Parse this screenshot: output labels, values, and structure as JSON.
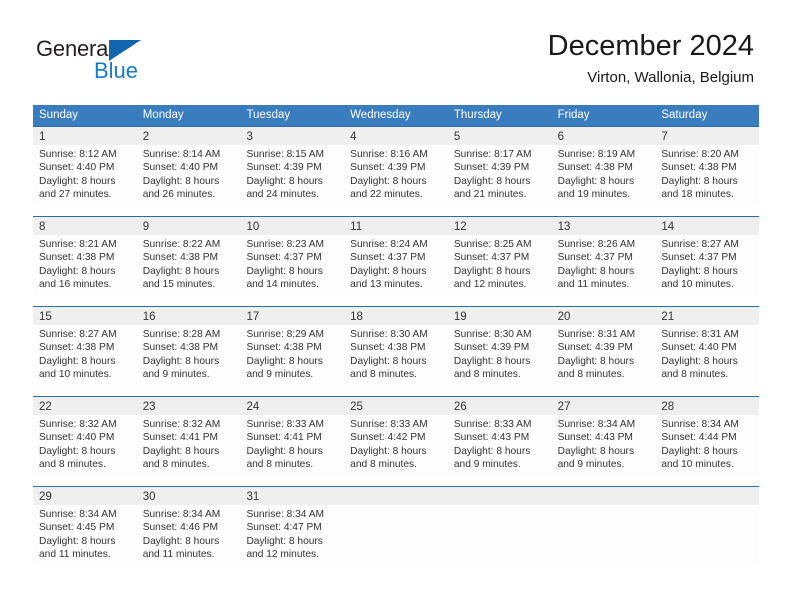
{
  "brand": {
    "name_part1": "General",
    "name_part2": "Blue",
    "accent_color": "#1a7ac4",
    "triangle_color": "#1166b0"
  },
  "header": {
    "title": "December 2024",
    "subtitle": "Virton, Wallonia, Belgium"
  },
  "theme": {
    "header_row_bg": "#3a7dbe",
    "week_separator": "#2b6ca8",
    "daynum_band_bg": "#efefef",
    "cell_bg": "#fdfdfd",
    "text_color": "#333333"
  },
  "weekdays": [
    "Sunday",
    "Monday",
    "Tuesday",
    "Wednesday",
    "Thursday",
    "Friday",
    "Saturday"
  ],
  "weeks": [
    [
      {
        "day": "1",
        "sunrise": "Sunrise: 8:12 AM",
        "sunset": "Sunset: 4:40 PM",
        "daylight1": "Daylight: 8 hours",
        "daylight2": "and 27 minutes."
      },
      {
        "day": "2",
        "sunrise": "Sunrise: 8:14 AM",
        "sunset": "Sunset: 4:40 PM",
        "daylight1": "Daylight: 8 hours",
        "daylight2": "and 26 minutes."
      },
      {
        "day": "3",
        "sunrise": "Sunrise: 8:15 AM",
        "sunset": "Sunset: 4:39 PM",
        "daylight1": "Daylight: 8 hours",
        "daylight2": "and 24 minutes."
      },
      {
        "day": "4",
        "sunrise": "Sunrise: 8:16 AM",
        "sunset": "Sunset: 4:39 PM",
        "daylight1": "Daylight: 8 hours",
        "daylight2": "and 22 minutes."
      },
      {
        "day": "5",
        "sunrise": "Sunrise: 8:17 AM",
        "sunset": "Sunset: 4:39 PM",
        "daylight1": "Daylight: 8 hours",
        "daylight2": "and 21 minutes."
      },
      {
        "day": "6",
        "sunrise": "Sunrise: 8:19 AM",
        "sunset": "Sunset: 4:38 PM",
        "daylight1": "Daylight: 8 hours",
        "daylight2": "and 19 minutes."
      },
      {
        "day": "7",
        "sunrise": "Sunrise: 8:20 AM",
        "sunset": "Sunset: 4:38 PM",
        "daylight1": "Daylight: 8 hours",
        "daylight2": "and 18 minutes."
      }
    ],
    [
      {
        "day": "8",
        "sunrise": "Sunrise: 8:21 AM",
        "sunset": "Sunset: 4:38 PM",
        "daylight1": "Daylight: 8 hours",
        "daylight2": "and 16 minutes."
      },
      {
        "day": "9",
        "sunrise": "Sunrise: 8:22 AM",
        "sunset": "Sunset: 4:38 PM",
        "daylight1": "Daylight: 8 hours",
        "daylight2": "and 15 minutes."
      },
      {
        "day": "10",
        "sunrise": "Sunrise: 8:23 AM",
        "sunset": "Sunset: 4:37 PM",
        "daylight1": "Daylight: 8 hours",
        "daylight2": "and 14 minutes."
      },
      {
        "day": "11",
        "sunrise": "Sunrise: 8:24 AM",
        "sunset": "Sunset: 4:37 PM",
        "daylight1": "Daylight: 8 hours",
        "daylight2": "and 13 minutes."
      },
      {
        "day": "12",
        "sunrise": "Sunrise: 8:25 AM",
        "sunset": "Sunset: 4:37 PM",
        "daylight1": "Daylight: 8 hours",
        "daylight2": "and 12 minutes."
      },
      {
        "day": "13",
        "sunrise": "Sunrise: 8:26 AM",
        "sunset": "Sunset: 4:37 PM",
        "daylight1": "Daylight: 8 hours",
        "daylight2": "and 11 minutes."
      },
      {
        "day": "14",
        "sunrise": "Sunrise: 8:27 AM",
        "sunset": "Sunset: 4:37 PM",
        "daylight1": "Daylight: 8 hours",
        "daylight2": "and 10 minutes."
      }
    ],
    [
      {
        "day": "15",
        "sunrise": "Sunrise: 8:27 AM",
        "sunset": "Sunset: 4:38 PM",
        "daylight1": "Daylight: 8 hours",
        "daylight2": "and 10 minutes."
      },
      {
        "day": "16",
        "sunrise": "Sunrise: 8:28 AM",
        "sunset": "Sunset: 4:38 PM",
        "daylight1": "Daylight: 8 hours",
        "daylight2": "and 9 minutes."
      },
      {
        "day": "17",
        "sunrise": "Sunrise: 8:29 AM",
        "sunset": "Sunset: 4:38 PM",
        "daylight1": "Daylight: 8 hours",
        "daylight2": "and 9 minutes."
      },
      {
        "day": "18",
        "sunrise": "Sunrise: 8:30 AM",
        "sunset": "Sunset: 4:38 PM",
        "daylight1": "Daylight: 8 hours",
        "daylight2": "and 8 minutes."
      },
      {
        "day": "19",
        "sunrise": "Sunrise: 8:30 AM",
        "sunset": "Sunset: 4:39 PM",
        "daylight1": "Daylight: 8 hours",
        "daylight2": "and 8 minutes."
      },
      {
        "day": "20",
        "sunrise": "Sunrise: 8:31 AM",
        "sunset": "Sunset: 4:39 PM",
        "daylight1": "Daylight: 8 hours",
        "daylight2": "and 8 minutes."
      },
      {
        "day": "21",
        "sunrise": "Sunrise: 8:31 AM",
        "sunset": "Sunset: 4:40 PM",
        "daylight1": "Daylight: 8 hours",
        "daylight2": "and 8 minutes."
      }
    ],
    [
      {
        "day": "22",
        "sunrise": "Sunrise: 8:32 AM",
        "sunset": "Sunset: 4:40 PM",
        "daylight1": "Daylight: 8 hours",
        "daylight2": "and 8 minutes."
      },
      {
        "day": "23",
        "sunrise": "Sunrise: 8:32 AM",
        "sunset": "Sunset: 4:41 PM",
        "daylight1": "Daylight: 8 hours",
        "daylight2": "and 8 minutes."
      },
      {
        "day": "24",
        "sunrise": "Sunrise: 8:33 AM",
        "sunset": "Sunset: 4:41 PM",
        "daylight1": "Daylight: 8 hours",
        "daylight2": "and 8 minutes."
      },
      {
        "day": "25",
        "sunrise": "Sunrise: 8:33 AM",
        "sunset": "Sunset: 4:42 PM",
        "daylight1": "Daylight: 8 hours",
        "daylight2": "and 8 minutes."
      },
      {
        "day": "26",
        "sunrise": "Sunrise: 8:33 AM",
        "sunset": "Sunset: 4:43 PM",
        "daylight1": "Daylight: 8 hours",
        "daylight2": "and 9 minutes."
      },
      {
        "day": "27",
        "sunrise": "Sunrise: 8:34 AM",
        "sunset": "Sunset: 4:43 PM",
        "daylight1": "Daylight: 8 hours",
        "daylight2": "and 9 minutes."
      },
      {
        "day": "28",
        "sunrise": "Sunrise: 8:34 AM",
        "sunset": "Sunset: 4:44 PM",
        "daylight1": "Daylight: 8 hours",
        "daylight2": "and 10 minutes."
      }
    ],
    [
      {
        "day": "29",
        "sunrise": "Sunrise: 8:34 AM",
        "sunset": "Sunset: 4:45 PM",
        "daylight1": "Daylight: 8 hours",
        "daylight2": "and 11 minutes."
      },
      {
        "day": "30",
        "sunrise": "Sunrise: 8:34 AM",
        "sunset": "Sunset: 4:46 PM",
        "daylight1": "Daylight: 8 hours",
        "daylight2": "and 11 minutes."
      },
      {
        "day": "31",
        "sunrise": "Sunrise: 8:34 AM",
        "sunset": "Sunset: 4:47 PM",
        "daylight1": "Daylight: 8 hours",
        "daylight2": "and 12 minutes."
      },
      {
        "day": "",
        "sunrise": "",
        "sunset": "",
        "daylight1": "",
        "daylight2": ""
      },
      {
        "day": "",
        "sunrise": "",
        "sunset": "",
        "daylight1": "",
        "daylight2": ""
      },
      {
        "day": "",
        "sunrise": "",
        "sunset": "",
        "daylight1": "",
        "daylight2": ""
      },
      {
        "day": "",
        "sunrise": "",
        "sunset": "",
        "daylight1": "",
        "daylight2": ""
      }
    ]
  ]
}
